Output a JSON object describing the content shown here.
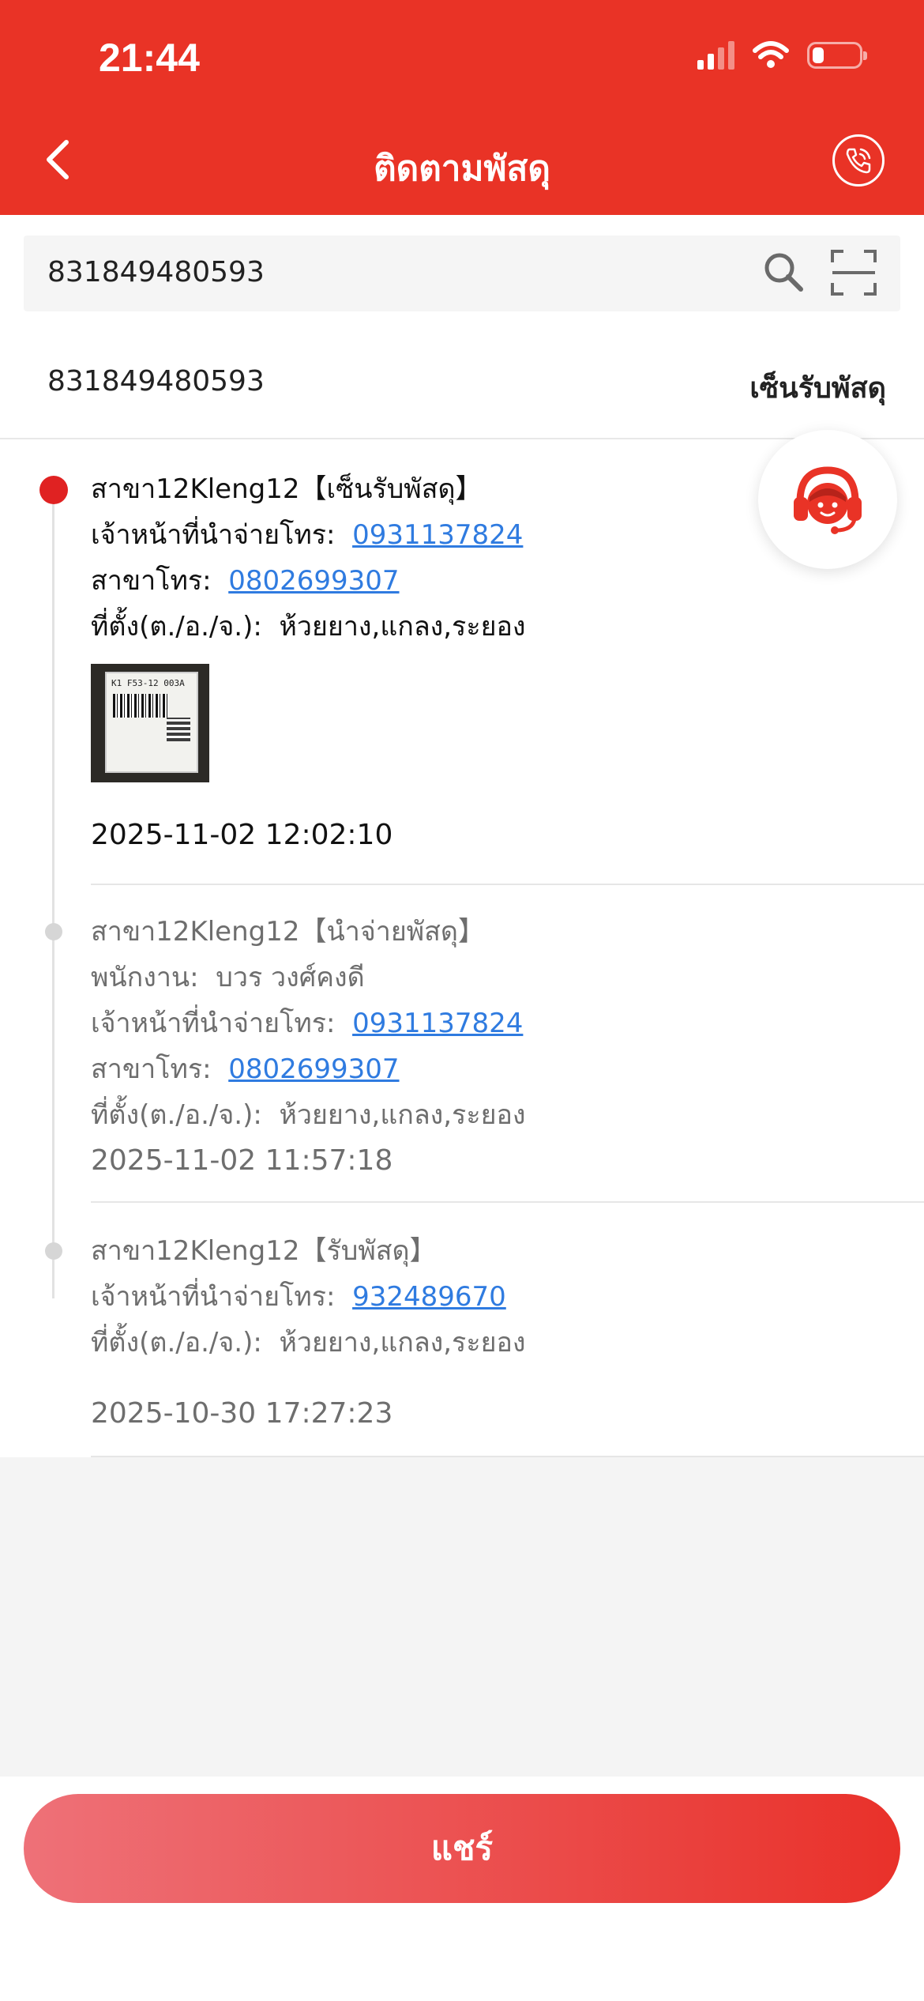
{
  "status_bar": {
    "time": "21:44"
  },
  "header": {
    "title": "ติดตามพัสดุ"
  },
  "search": {
    "value": "831849480593"
  },
  "summary": {
    "tracking_number": "831849480593",
    "status": "เซ็นรับพัสดุ"
  },
  "events": [
    {
      "title": "สาขา12Kleng12【เซ็นรับพัสดุ】",
      "courier_label": "เจ้าหน้าที่นำจ่ายโทร:",
      "courier_phone": "0931137824",
      "branch_label": "สาขาโทร:",
      "branch_phone": "0802699307",
      "location_label": "ที่ตั้ง(ต./อ./จ.):",
      "location": "ห้วยยาง,แกลง,ระยอง",
      "photo_text": "K1 F53-12 003A",
      "timestamp": "2025-11-02 12:02:10"
    },
    {
      "title": "สาขา12Kleng12【นำจ่ายพัสดุ】",
      "staff_label": "พนักงาน:",
      "staff_name": "บวร วงศ์คงดี",
      "courier_label": "เจ้าหน้าที่นำจ่ายโทร:",
      "courier_phone": "0931137824",
      "branch_label": "สาขาโทร:",
      "branch_phone": "0802699307",
      "location_label": "ที่ตั้ง(ต./อ./จ.):",
      "location": "ห้วยยาง,แกลง,ระยอง",
      "timestamp": "2025-11-02 11:57:18"
    },
    {
      "title": "สาขา12Kleng12【รับพัสดุ】",
      "courier_label": "เจ้าหน้าที่นำจ่ายโทร:",
      "courier_phone": "932489670",
      "location_label": "ที่ตั้ง(ต./อ./จ.):",
      "location": "ห้วยยาง,แกลง,ระยอง",
      "timestamp": "2025-10-30 17:27:23"
    }
  ],
  "share_button": {
    "label": "แชร์"
  },
  "icons": {
    "back": "chevron-left-icon",
    "call": "phone-call-icon",
    "search": "search-icon",
    "scan": "scan-icon",
    "support": "customer-support-icon"
  },
  "colors": {
    "brand_red": "#e93326",
    "link_blue": "#2f7be0",
    "active_dot": "#e02222"
  }
}
